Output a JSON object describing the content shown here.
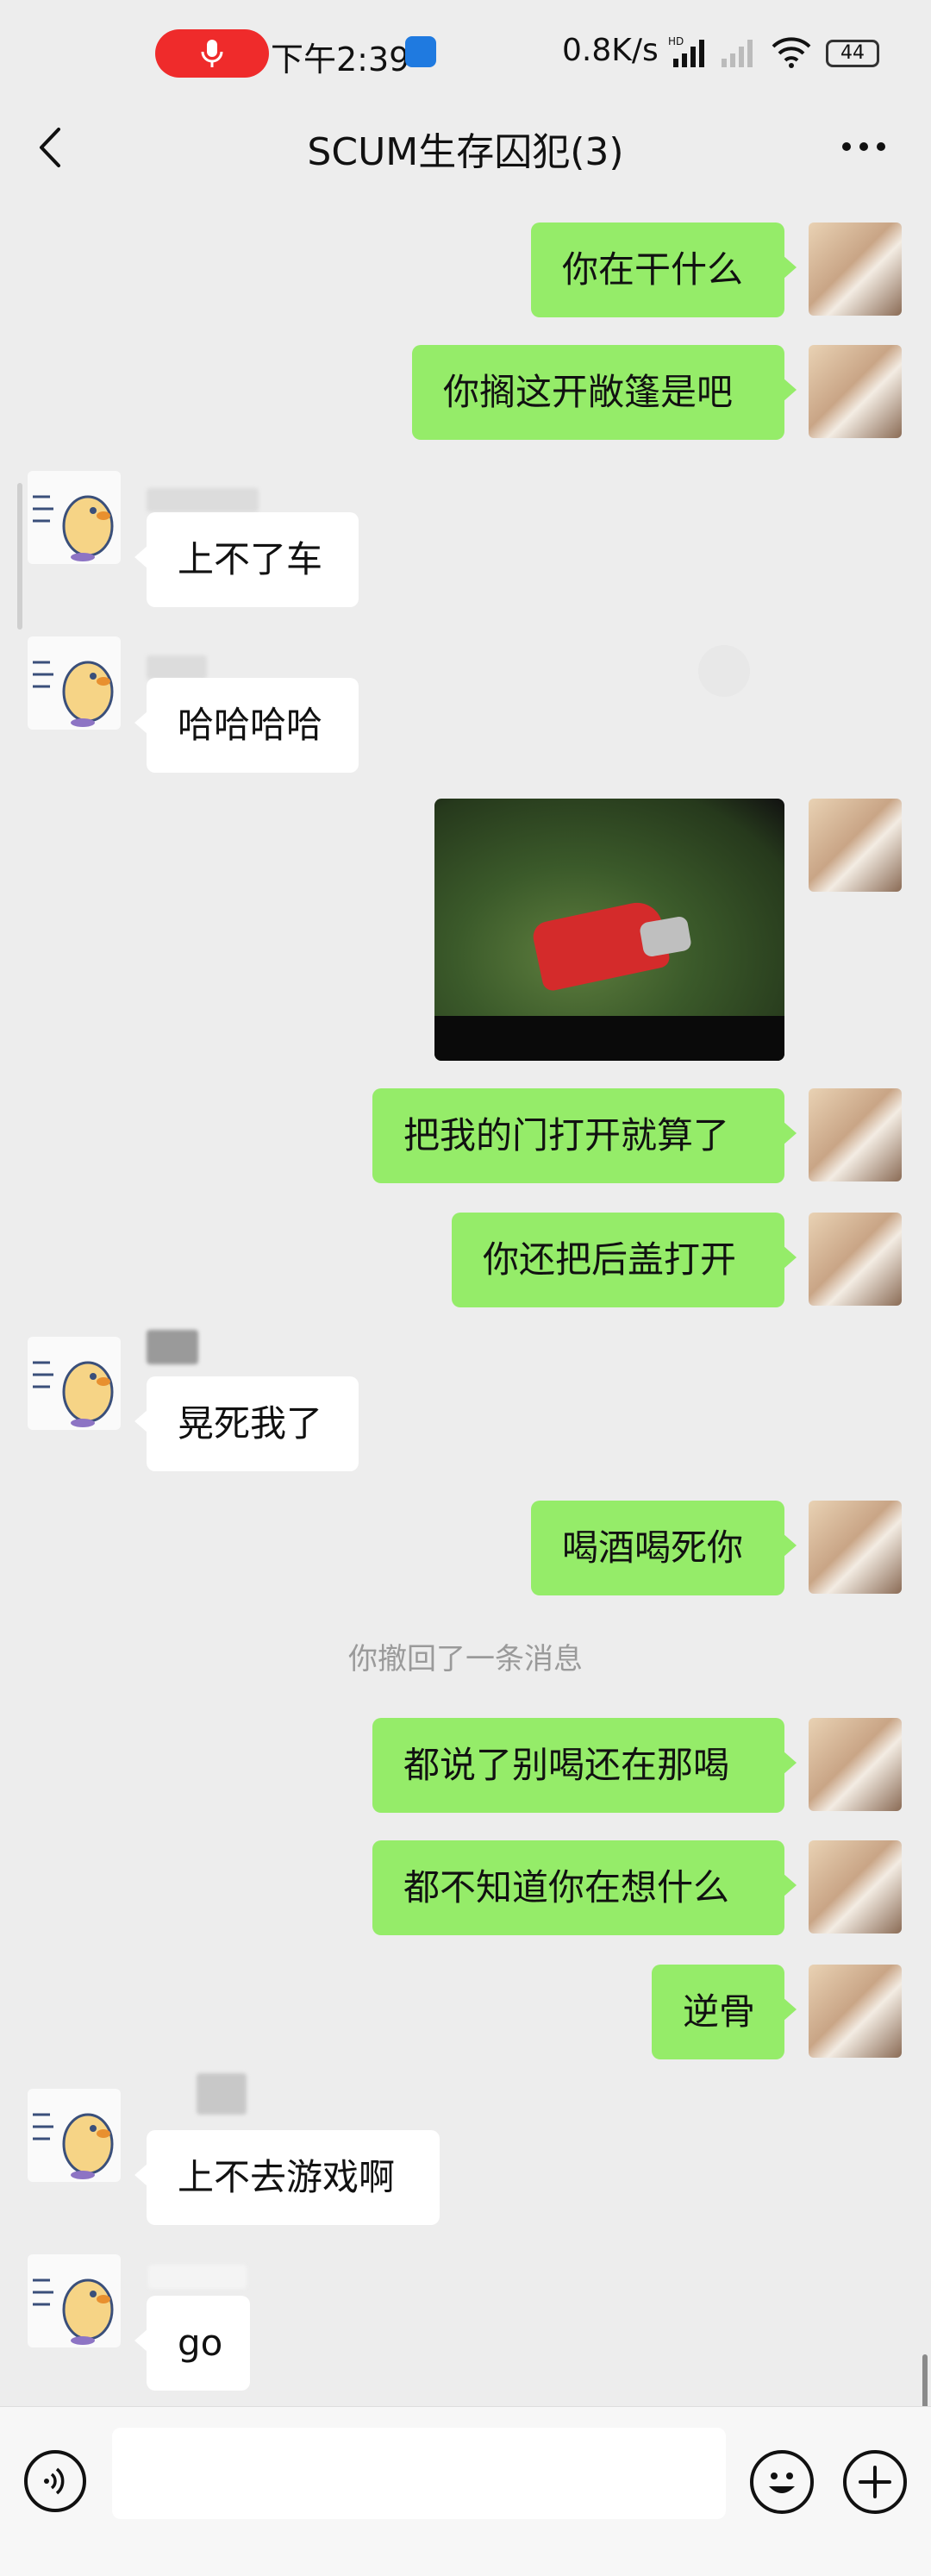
{
  "status_bar": {
    "time": "下午2:39",
    "net_speed": "0.8K/s",
    "battery": "44",
    "icons": [
      "microphone-icon",
      "app-notification-icon",
      "hd-signal-icon",
      "signal-icon",
      "wifi-icon",
      "battery-icon"
    ]
  },
  "nav": {
    "title": "SCUM生存囚犯(3)",
    "back_icon": "chevron-left-icon",
    "more_icon": "more-dots-icon"
  },
  "messages": [
    {
      "side": "me",
      "text": "你在干什么"
    },
    {
      "side": "me",
      "text": "你搁这开敞篷是吧"
    },
    {
      "side": "other",
      "text": "上不了车"
    },
    {
      "side": "other",
      "text": "哈哈哈哈"
    },
    {
      "side": "me",
      "type": "image",
      "description": "game screenshot"
    },
    {
      "side": "me",
      "text": "把我的门打开就算了"
    },
    {
      "side": "me",
      "text": "你还把后盖打开"
    },
    {
      "side": "other",
      "text": "晃死我了"
    },
    {
      "side": "me",
      "text": "喝酒喝死你"
    },
    {
      "side": "system",
      "text": "你撤回了一条消息"
    },
    {
      "side": "me",
      "text": "都说了别喝还在那喝"
    },
    {
      "side": "me",
      "text": "都不知道你在想什么"
    },
    {
      "side": "me",
      "text": "逆骨"
    },
    {
      "side": "other",
      "text": "上不去游戏啊"
    },
    {
      "side": "other",
      "text": "go"
    }
  ],
  "input_bar": {
    "value": "",
    "icons": [
      "voice-icon",
      "emoji-icon",
      "plus-icon"
    ]
  },
  "colors": {
    "background": "#ededed",
    "bubble_me": "#95ec69",
    "bubble_other": "#ffffff",
    "recording_pill": "#ef2b2b"
  }
}
